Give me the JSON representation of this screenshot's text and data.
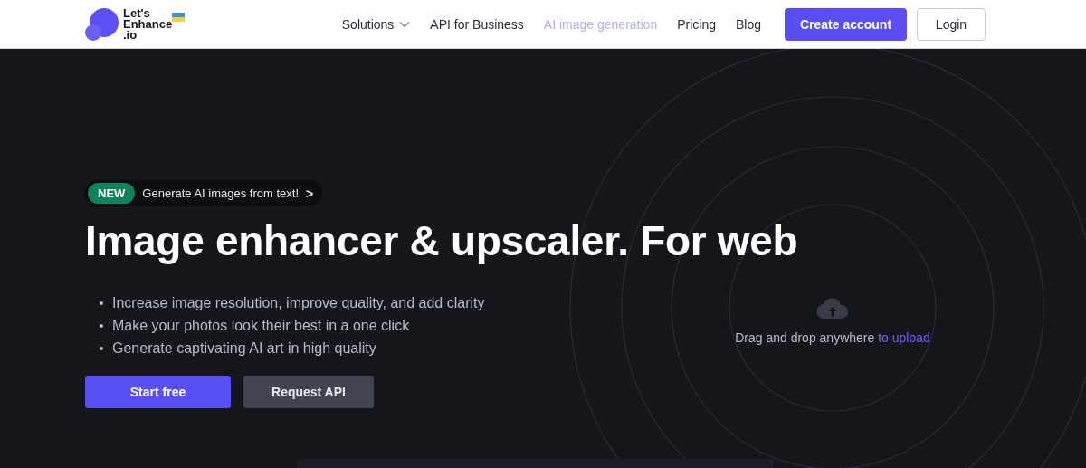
{
  "header": {
    "logo": {
      "text": "Let's Enhance .io"
    },
    "nav": [
      {
        "label": "Solutions",
        "dropdown": true,
        "selected": false
      },
      {
        "label": "API for Business",
        "dropdown": false,
        "selected": false
      },
      {
        "label": "AI image generation",
        "dropdown": false,
        "selected": true
      },
      {
        "label": "Pricing",
        "dropdown": false,
        "selected": false
      },
      {
        "label": "Blog",
        "dropdown": false,
        "selected": false
      }
    ],
    "buttons": [
      {
        "label": "Create account",
        "kind": "primary"
      },
      {
        "label": "Login",
        "kind": "outline"
      }
    ]
  },
  "hero": {
    "badge": {
      "tag": "NEW",
      "text": "Generate AI images from text!",
      "arrow": ">"
    },
    "title": "Image enhancer & upscaler. For web",
    "bullets": [
      "Increase image resolution, improve quality, and add clarity",
      "Make your photos look their best in a one click",
      "Generate captivating AI art in high quality"
    ],
    "buttons": [
      {
        "label": "Start free",
        "kind": "primary"
      },
      {
        "label": "Request API",
        "kind": "secondary"
      }
    ]
  },
  "dropzone": {
    "text": "Drag and drop anywhere",
    "link": "to upload"
  }
}
